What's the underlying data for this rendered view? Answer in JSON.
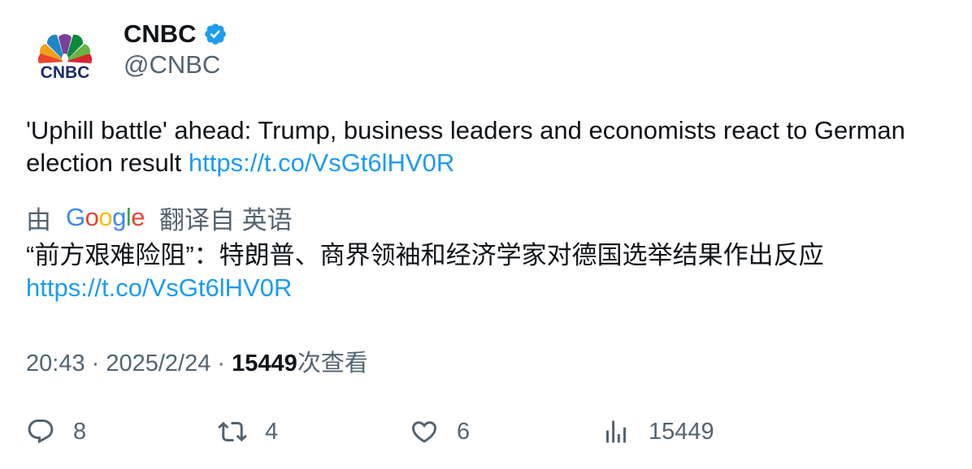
{
  "author": {
    "display_name": "CNBC",
    "handle": "@CNBC",
    "avatar_text": "CNBC",
    "verified": true,
    "verified_color": "#1d9bf0"
  },
  "tweet": {
    "text": "'Uphill battle' ahead: Trump, business leaders and economists react to German election result ",
    "link": "https://t.co/VsGt6lHV0R"
  },
  "translation": {
    "by_label": "由",
    "provider": "Google",
    "from_label": "翻译自 英语",
    "text": "“前方艰难险阻”：特朗普、商界领袖和经济学家对德国选举结果作出反应",
    "link": "https://t.co/VsGt6lHV0R"
  },
  "meta": {
    "time": "20:43",
    "separator": " · ",
    "date": "2025/2/24",
    "views": "15449",
    "views_label": "次查看"
  },
  "actions": {
    "reply_count": "8",
    "retweet_count": "4",
    "like_count": "6",
    "views_count": "15449"
  },
  "colors": {
    "text": "#0f1419",
    "secondary": "#536471",
    "link": "#1d9bf0"
  }
}
